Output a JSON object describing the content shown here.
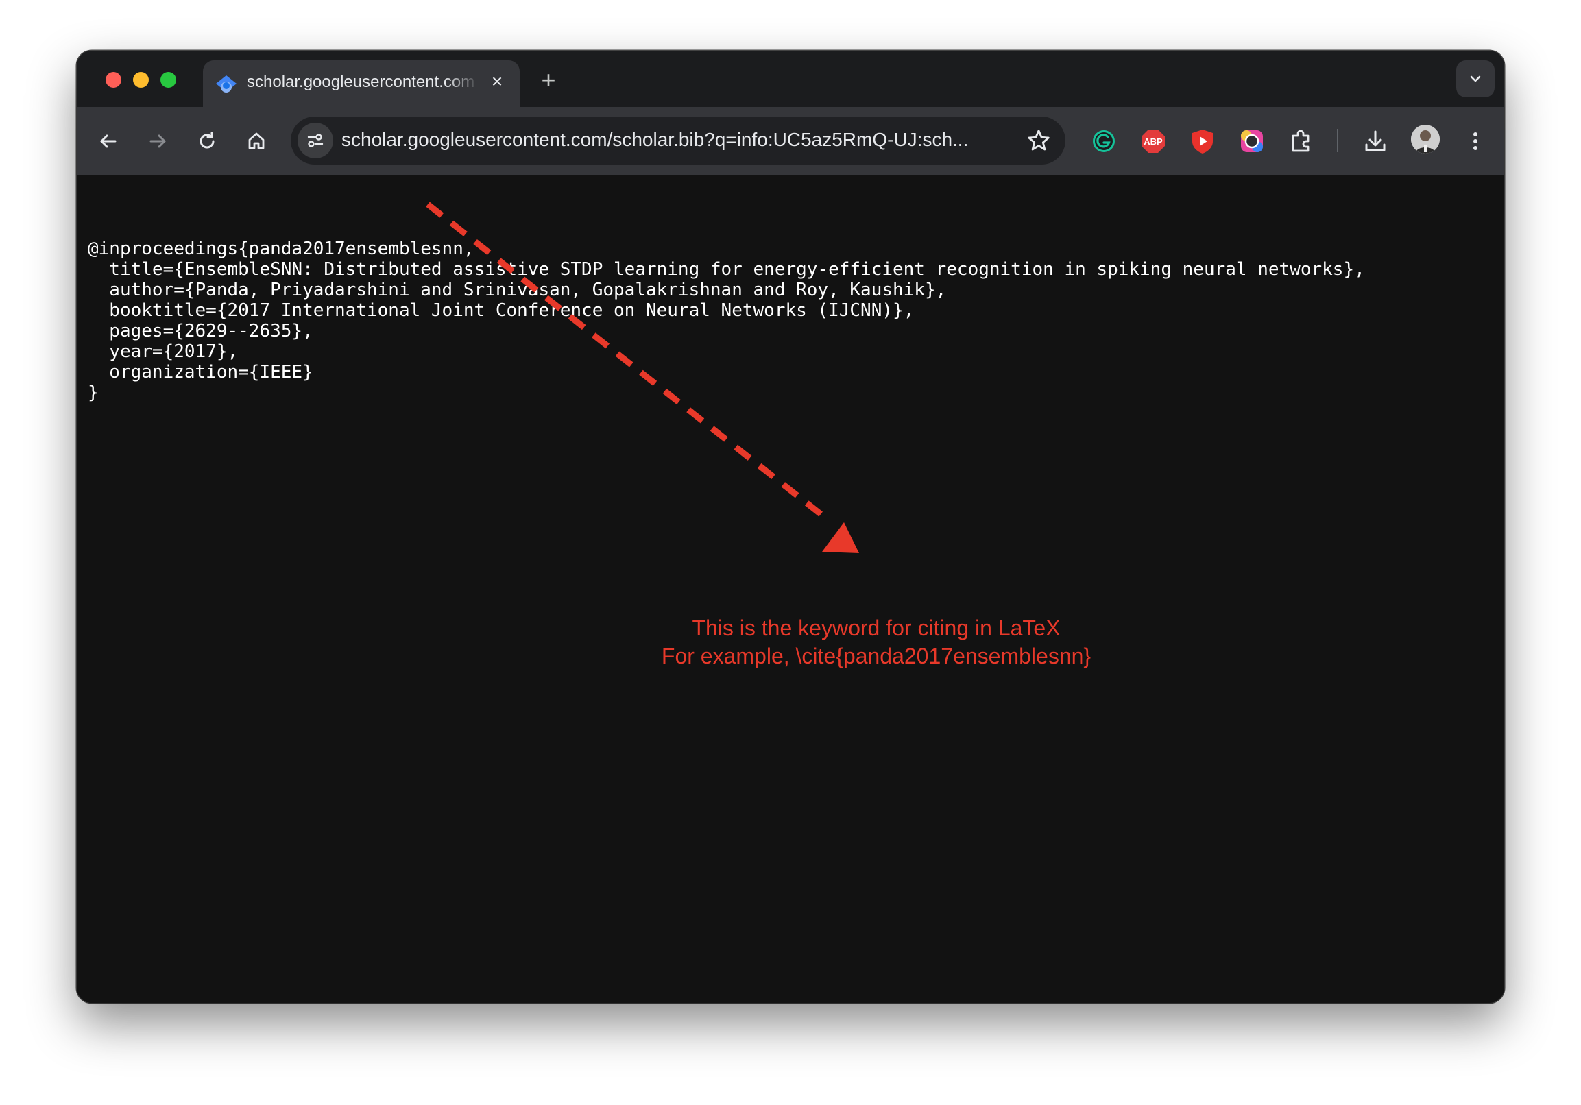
{
  "browser": {
    "tab": {
      "title": "scholar.googleusercontent.com",
      "favicon": "google-scholar-icon",
      "close_icon": "close-icon"
    },
    "new_tab_label": "+",
    "url": "scholar.googleusercontent.com/scholar.bib?q=info:UC5az5RmQ-UJ:sch...",
    "toolbar_icons": [
      "back-arrow-icon",
      "forward-arrow-icon",
      "reload-icon",
      "home-icon",
      "site-info-icon",
      "bookmark-star-icon"
    ],
    "extensions": [
      "grammarly-icon",
      "adblock-plus-icon",
      "youtube-extension-icon",
      "color-picker-icon",
      "extensions-puzzle-icon",
      "download-icon",
      "avatar",
      "kebab-menu-icon"
    ]
  },
  "bibtex": {
    "lines": [
      "@inproceedings{panda2017ensemblesnn,",
      "  title={EnsembleSNN: Distributed assistive STDP learning for energy-efficient recognition in spiking neural networks},",
      "  author={Panda, Priyadarshini and Srinivasan, Gopalakrishnan and Roy, Kaushik},",
      "  booktitle={2017 International Joint Conference on Neural Networks (IJCNN)},",
      "  pages={2629--2635},",
      "  year={2017},",
      "  organization={IEEE}",
      "}"
    ]
  },
  "annotation": {
    "line1": "This is the keyword for citing in LaTeX",
    "line2": "For example, \\cite{panda2017ensemblesnn}",
    "color": "#e8392a"
  },
  "colors": {
    "tabstrip": "#1b1c1e",
    "toolbar": "#35363a",
    "omnibox": "#202124",
    "page_bg": "#121212",
    "text": "#ffffff"
  }
}
